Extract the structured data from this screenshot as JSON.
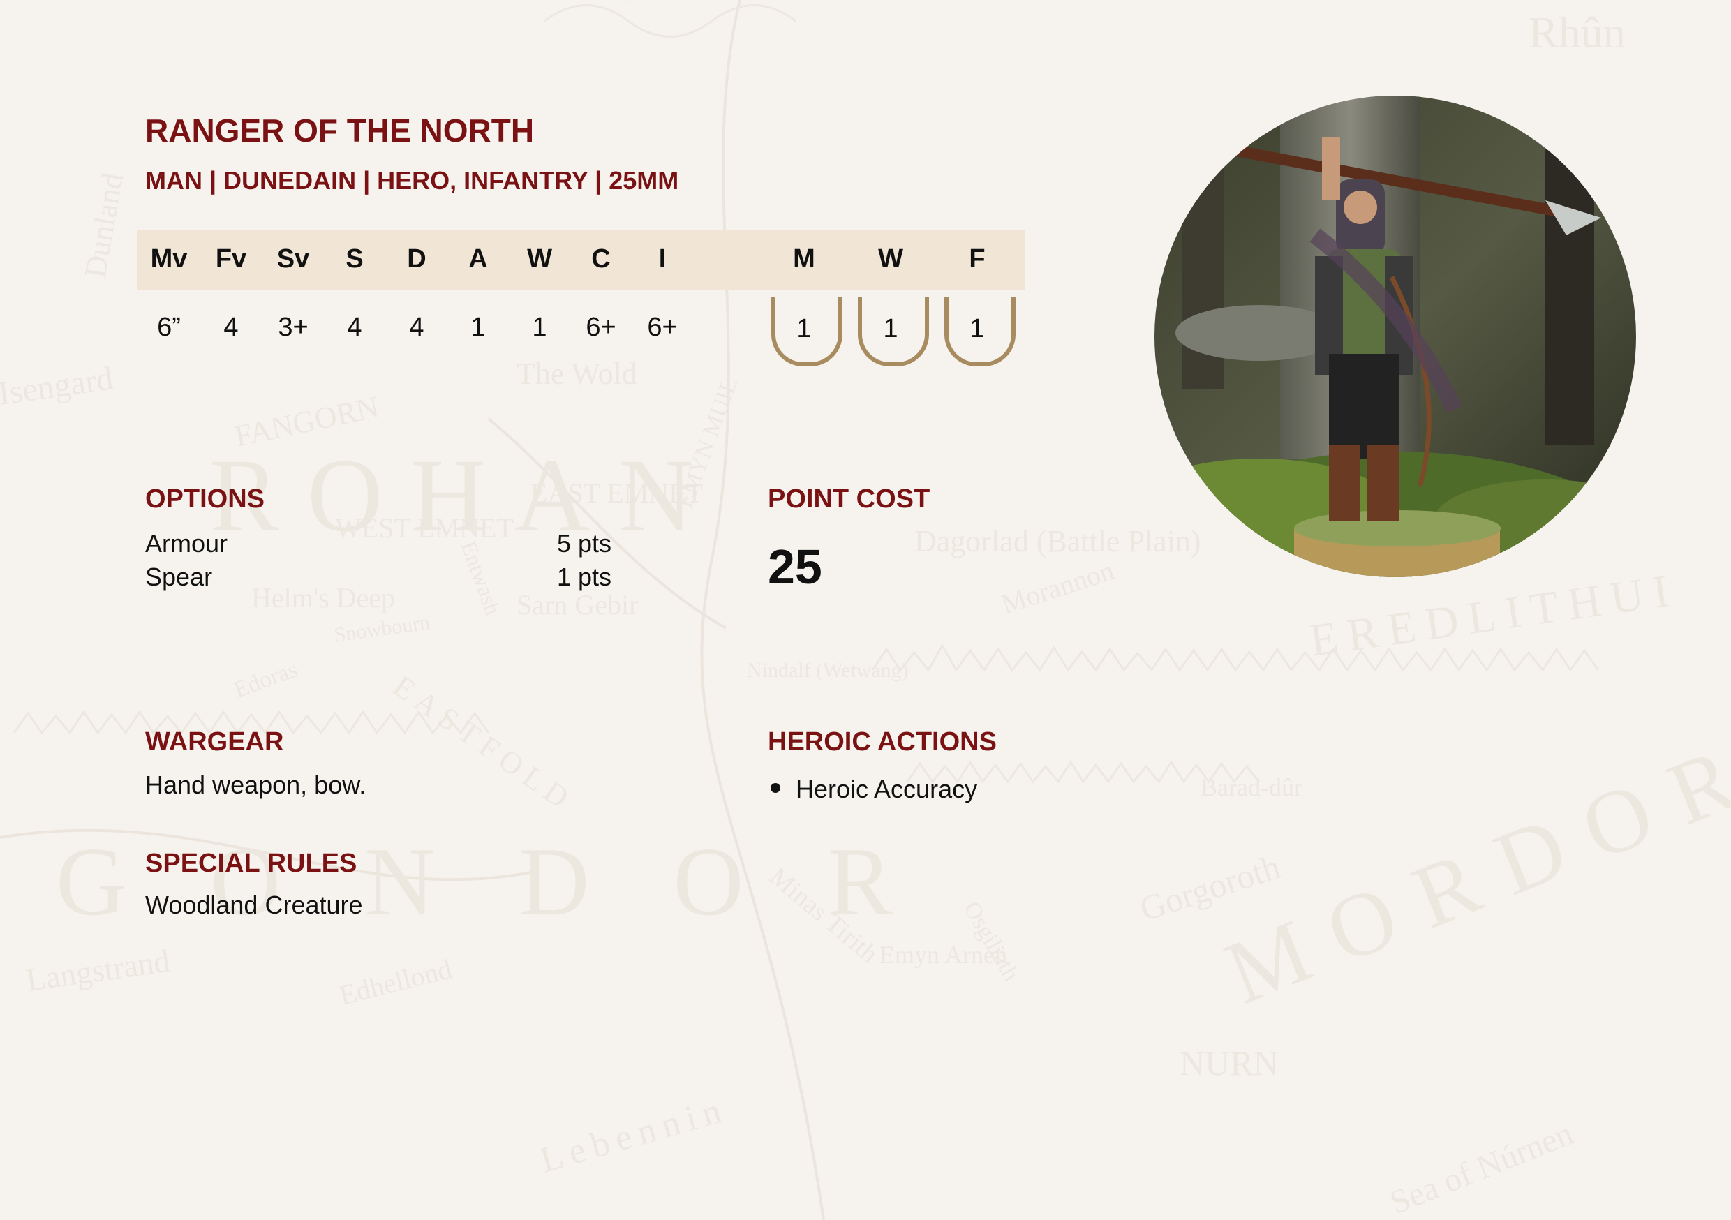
{
  "profile": {
    "name": "RANGER OF THE NORTH",
    "keywords": "MAN | DUNEDAIN | HERO, INFANTRY | 25MM"
  },
  "stats": {
    "headers": [
      "Mv",
      "Fv",
      "Sv",
      "S",
      "D",
      "A",
      "W",
      "C",
      "I"
    ],
    "values": [
      "6”",
      "4",
      "3+",
      "4",
      "4",
      "1",
      "1",
      "6+",
      "6+"
    ]
  },
  "heroic": {
    "headers": [
      "M",
      "W",
      "F"
    ],
    "values": [
      "1",
      "1",
      "1"
    ]
  },
  "options": {
    "heading": "OPTIONS",
    "items": [
      {
        "name": "Armour",
        "cost": "5 pts"
      },
      {
        "name": "Spear",
        "cost": "1 pts"
      }
    ]
  },
  "point_cost": {
    "heading": "POINT COST",
    "value": "25"
  },
  "wargear": {
    "heading": "WARGEAR",
    "text": "Hand weapon, bow."
  },
  "special_rules": {
    "heading": "SPECIAL RULES",
    "text": "Woodland Creature"
  },
  "heroic_actions": {
    "heading": "HEROIC ACTIONS",
    "items": [
      "Heroic Accuracy"
    ]
  },
  "map_labels": [
    "Rhûn",
    "ROHAN",
    "MORDOR",
    "EMYN MUIL",
    "EAST EMNET",
    "WEST EMNET",
    "FANGORN",
    "Isengard",
    "EREDLITHUI",
    "Dagorlad (Battle Plain)",
    "Morannon",
    "NURN",
    "Barad-dûr",
    "Sea of Núrnen",
    "Gorgoroth",
    "Edhellond",
    "Langstrand",
    "Lebennin",
    "Minas Tirith",
    "GONDOR",
    "The Wold",
    "Sarn Gebir",
    "Dunland",
    "Helm's Deep",
    "Edoras",
    "Snowbourn",
    "EASTFOLD",
    "Nindalf (Wetwang)",
    "Emyn Arnen",
    "Osgiliath",
    "Entwash"
  ],
  "colors": {
    "accent": "#7a1214",
    "stat_bar": "#f1e5d6",
    "shield_border": "#a88c60",
    "background": "#f6f3ee"
  }
}
